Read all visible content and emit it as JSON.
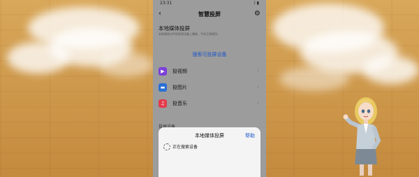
{
  "status_bar": {
    "time": "23:31",
    "right_icons": "⟟ ▮"
  },
  "nav": {
    "title": "智慧投屏"
  },
  "local_media": {
    "title": "本地媒体投屏",
    "subtitle": "本地媒体文件投屏到设备上播放，手机正常使用。",
    "search_link": "搜索可投屏设备"
  },
  "items": [
    {
      "label": "投视频",
      "icon": "play-icon"
    },
    {
      "label": "投图片",
      "icon": "image-icon"
    },
    {
      "label": "投音乐",
      "icon": "music-icon"
    }
  ],
  "section2_title": "投屏设备",
  "sheet": {
    "title": "本地媒体投屏",
    "help": "帮助",
    "status": "正在搜索设备"
  },
  "colors": {
    "accent": "#1b55c9",
    "video": "#7b3fd8",
    "photo": "#2a6fd6",
    "music": "#e23b4b"
  }
}
